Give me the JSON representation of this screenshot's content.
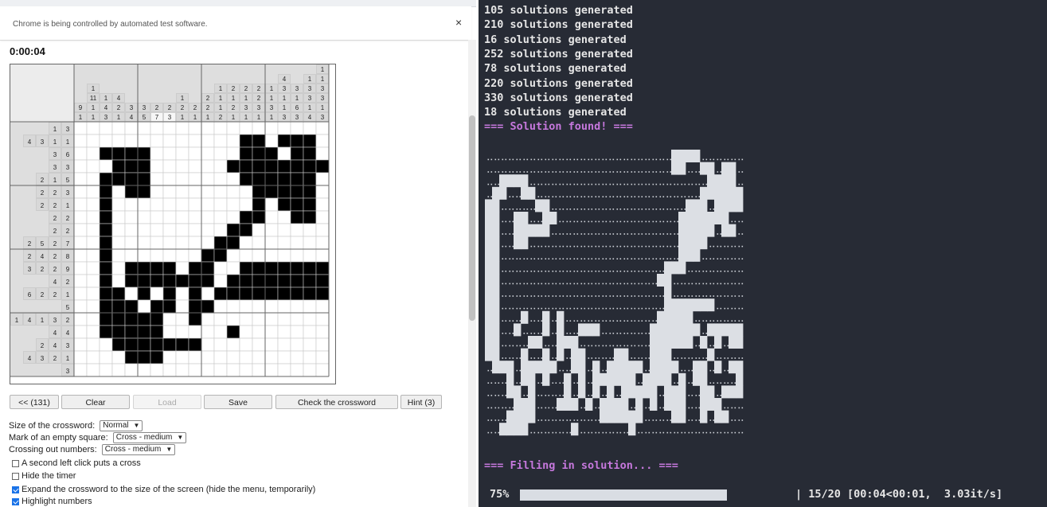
{
  "browser": {
    "infobar_text": "Chrome is being controlled by automated test software.",
    "close_glyph": "×"
  },
  "game": {
    "timer": "0:00:04",
    "rows": 20,
    "cols": 20,
    "column_clues": [
      [
        "9",
        "1"
      ],
      [
        "1",
        "11",
        "1",
        "1"
      ],
      [
        "1",
        "4",
        "3"
      ],
      [
        "4",
        "2",
        "1"
      ],
      [
        "3",
        "4"
      ],
      [
        "3",
        "5"
      ],
      [
        "2",
        "7"
      ],
      [
        "2",
        "3"
      ],
      [
        "1",
        "2",
        "1"
      ],
      [
        "2",
        "1"
      ],
      [
        "2",
        "2",
        "1"
      ],
      [
        "1",
        "1",
        "1",
        "2"
      ],
      [
        "2",
        "1",
        "2",
        "1"
      ],
      [
        "2",
        "1",
        "3",
        "1"
      ],
      [
        "2",
        "2",
        "3",
        "1"
      ],
      [
        "1",
        "1",
        "3",
        "1"
      ],
      [
        "4",
        "3",
        "1",
        "1",
        "3"
      ],
      [
        "3",
        "1",
        "6",
        "3"
      ],
      [
        "1",
        "3",
        "3",
        "1",
        "4"
      ],
      [
        "1",
        "1",
        "3",
        "3",
        "1",
        "3"
      ]
    ],
    "row_clues": [
      [
        "1",
        "3"
      ],
      [
        "4",
        "3",
        "1",
        "1"
      ],
      [
        "3",
        "6"
      ],
      [
        "3",
        "3"
      ],
      [
        "2",
        "1",
        "5"
      ],
      [
        "2",
        "2",
        "3"
      ],
      [
        "2",
        "2",
        "1"
      ],
      [
        "2",
        "2"
      ],
      [
        "2",
        "2"
      ],
      [
        "2",
        "5",
        "2",
        "7"
      ],
      [
        "2",
        "4",
        "2",
        "8"
      ],
      [
        "3",
        "2",
        "2",
        "9"
      ],
      [
        "4",
        "2"
      ],
      [
        "6",
        "2",
        "2",
        "1"
      ],
      [
        "5"
      ],
      [
        "1",
        "4",
        "1",
        "3",
        "2"
      ],
      [
        "4",
        "4"
      ],
      [
        "2",
        "4",
        "3"
      ],
      [
        "4",
        "3",
        "2",
        "1"
      ],
      [
        "3"
      ]
    ],
    "grid": [
      "....................",
      ".............##.###.",
      "..####.......###.##.",
      "...###......########",
      "..####.......######.",
      "..#.##........#####.",
      "..#...........#.###.",
      "..#..........##..##.",
      "..#.........##......",
      "..#........##.......",
      "..#.......##........",
      "..#.####.##..#######",
      "..#.#######.########",
      "..##.#.#.#.#########",
      "..###.##.##.........",
      "..#####..#..........",
      "..#####.....#.......",
      "...#######..........",
      "....###.............",
      "...................."
    ],
    "buttons": {
      "back": "<< (131)",
      "clear": "Clear",
      "load": "Load",
      "save": "Save",
      "check": "Check the crossword",
      "hint": "Hint (3)"
    },
    "settings": {
      "size_label": "Size of the crossword:",
      "size_value": "Normal",
      "mark_label": "Mark of an empty square:",
      "mark_value": "Cross - medium",
      "crossing_label": "Crossing out numbers:",
      "crossing_value": "Cross - medium",
      "opt1": "A second left click puts a cross",
      "opt2": "Hide the timer",
      "opt3": "Expand the crossword to the size of the screen (hide the menu, temporarily)",
      "opt4": "Highlight numbers"
    }
  },
  "terminal": {
    "lines": [
      "105 solutions generated",
      "210 solutions generated",
      "16 solutions generated",
      "252 solutions generated",
      "78 solutions generated",
      "220 solutions generated",
      "330 solutions generated",
      "18 solutions generated"
    ],
    "found": "=== Solution found! ===",
    "filling": "=== Filling in solution... ===",
    "art": [
      "..........................####......",
      "..........................##..##.##.",
      "..####.........................####.",
      ".##..##.......................######",
      "##.....##...................###.####",
      "##..##..##.................#######..",
      "##..#####..................#####.##.",
      "##..##.....................####.....",
      "##.........................###......",
      "##.......................###........",
      "##......................##..........",
      "##.......................#..........",
      "##.......................#######....",
      "##...#..#.#.............#####.......",
      "##..#...#.#..###.......#######.#####",
      "##....##..###..........######.#.#.##",
      "##...#..#.#.##....##...###.....#....",
      ".###.#####..##.#.#####.####..##.#.##",
      "...#.##.#..#.#.######.####.#.##....#",
      "...##.#....#.#.#.#.#####.###..##.###",
      "....###...###.#.####.#.#.###..###...",
      "...####.........######....##..#.##..",
      "..####......#.......#..............."
    ],
    "progress_pct": "75%",
    "progress_fraction": 0.75,
    "progress_stats": "| 15/20 [00:04<00:01,  3.03it/s]"
  }
}
